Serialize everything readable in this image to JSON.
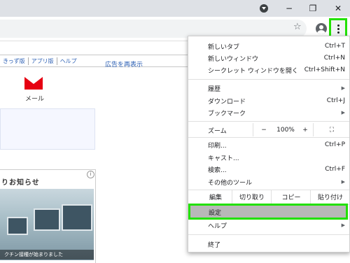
{
  "window": {
    "minimize": "−",
    "maximize": "❐",
    "close": "✕"
  },
  "page": {
    "links": [
      "きっず版",
      "アプリ版",
      "ヘルプ"
    ],
    "ad_link": "広告を再表示",
    "mail_label": "メール",
    "notice_title": "りお知らせ",
    "notice_caption": "クチン接種が始まりました",
    "notice_info": "i"
  },
  "menu": {
    "items": [
      {
        "label": "新しいタブ",
        "shortcut": "Ctrl+T"
      },
      {
        "label": "新しいウィンドウ",
        "shortcut": "Ctrl+N"
      },
      {
        "label": "シークレット ウィンドウを開く",
        "shortcut": "Ctrl+Shift+N"
      },
      {
        "label": "履歴",
        "arrow": "▶"
      },
      {
        "label": "ダウンロード",
        "shortcut": "Ctrl+J"
      },
      {
        "label": "ブックマーク",
        "arrow": "▶"
      },
      {
        "label": "印刷...",
        "shortcut": "Ctrl+P"
      },
      {
        "label": "キャスト..."
      },
      {
        "label": "検索...",
        "shortcut": "Ctrl+F"
      },
      {
        "label": "その他のツール",
        "arrow": "▶"
      },
      {
        "label": "設定"
      },
      {
        "label": "ヘルプ",
        "arrow": "▶"
      },
      {
        "label": "終了"
      }
    ],
    "zoom": {
      "label": "ズーム",
      "minus": "−",
      "value": "100%",
      "plus": "+",
      "fullscreen": "⛶"
    },
    "edit": {
      "label": "編集",
      "cut": "切り取り",
      "copy": "コピー",
      "paste": "貼り付け"
    }
  }
}
